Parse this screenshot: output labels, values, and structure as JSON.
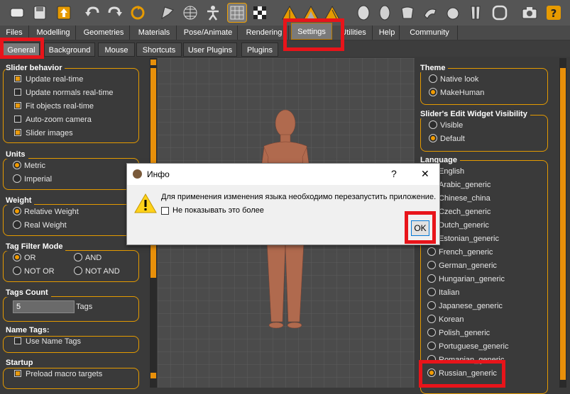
{
  "toolbar": {
    "icons": [
      "new-icon",
      "save-icon",
      "export-icon",
      "undo-icon",
      "redo-icon",
      "reset-icon",
      "smooth-icon",
      "wireframe-icon",
      "pose-icon",
      "grid-icon",
      "checker-icon",
      "front-view-icon",
      "back-view-icon",
      "side-view-icon",
      "head-icon",
      "face-icon",
      "torso-icon",
      "arm-icon",
      "hand-icon",
      "legs-icon",
      "feet-icon",
      "screenshot-icon",
      "help-icon"
    ]
  },
  "main_tabs": [
    "Files",
    "Modelling",
    "Geometries",
    "Materials",
    "Pose/Animate",
    "Rendering",
    "Settings",
    "Utilities",
    "Help",
    "Community"
  ],
  "sub_tabs": [
    "General",
    "Background",
    "Mouse",
    "Shortcuts",
    "User Plugins",
    "Plugins"
  ],
  "left": {
    "slider_behavior": {
      "title": "Slider behavior",
      "items": [
        {
          "label": "Update real-time",
          "checked": true
        },
        {
          "label": "Update normals real-time",
          "checked": false
        },
        {
          "label": "Fit objects real-time",
          "checked": true
        },
        {
          "label": "Auto-zoom camera",
          "checked": false
        },
        {
          "label": "Slider images",
          "checked": true
        }
      ]
    },
    "units": {
      "title": "Units",
      "items": [
        {
          "label": "Metric",
          "selected": true
        },
        {
          "label": "Imperial",
          "selected": false
        }
      ]
    },
    "weight": {
      "title": "Weight",
      "items": [
        {
          "label": "Relative Weight",
          "selected": true
        },
        {
          "label": "Real Weight",
          "selected": false
        }
      ]
    },
    "tag_filter": {
      "title": "Tag Filter Mode",
      "items": [
        {
          "label": "OR",
          "selected": true
        },
        {
          "label": "AND",
          "selected": false
        },
        {
          "label": "NOT OR",
          "selected": false
        },
        {
          "label": "NOT AND",
          "selected": false
        }
      ]
    },
    "tags_count": {
      "title": "Tags Count",
      "value": "5",
      "label": "Tags"
    },
    "name_tags": {
      "title": "Name Tags:",
      "label": "Use Name Tags",
      "checked": false
    },
    "startup": {
      "title": "Startup",
      "label": "Preload macro targets",
      "checked": true
    }
  },
  "right": {
    "theme": {
      "title": "Theme",
      "items": [
        {
          "label": "Native look",
          "selected": false
        },
        {
          "label": "MakeHuman",
          "selected": true
        }
      ]
    },
    "slider_widget": {
      "title": "Slider's Edit Widget Visibility",
      "items": [
        {
          "label": "Visible",
          "selected": false
        },
        {
          "label": "Default",
          "selected": true
        }
      ]
    },
    "language": {
      "title": "Language",
      "items": [
        "English",
        "Arabic_generic",
        "Chinese_china",
        "Czech_generic",
        "Dutch_generic",
        "Estonian_generic",
        "French_generic",
        "German_generic",
        "Hungarian_generic",
        "Italian",
        "Japanese_generic",
        "Korean",
        "Polish_generic",
        "Portuguese_generic",
        "Romanian_generic",
        "Russian_generic"
      ],
      "selected": "Russian_generic"
    }
  },
  "dialog": {
    "title": "Инфо",
    "help": "?",
    "close": "✕",
    "message": "Для применения изменения языка необходимо перезапустить приложение.",
    "checkbox_label": "Не показывать это более",
    "ok": "OK"
  },
  "colors": {
    "accent": "#f29b00",
    "highlight": "#e8141a",
    "panel": "#3a3a3a"
  }
}
